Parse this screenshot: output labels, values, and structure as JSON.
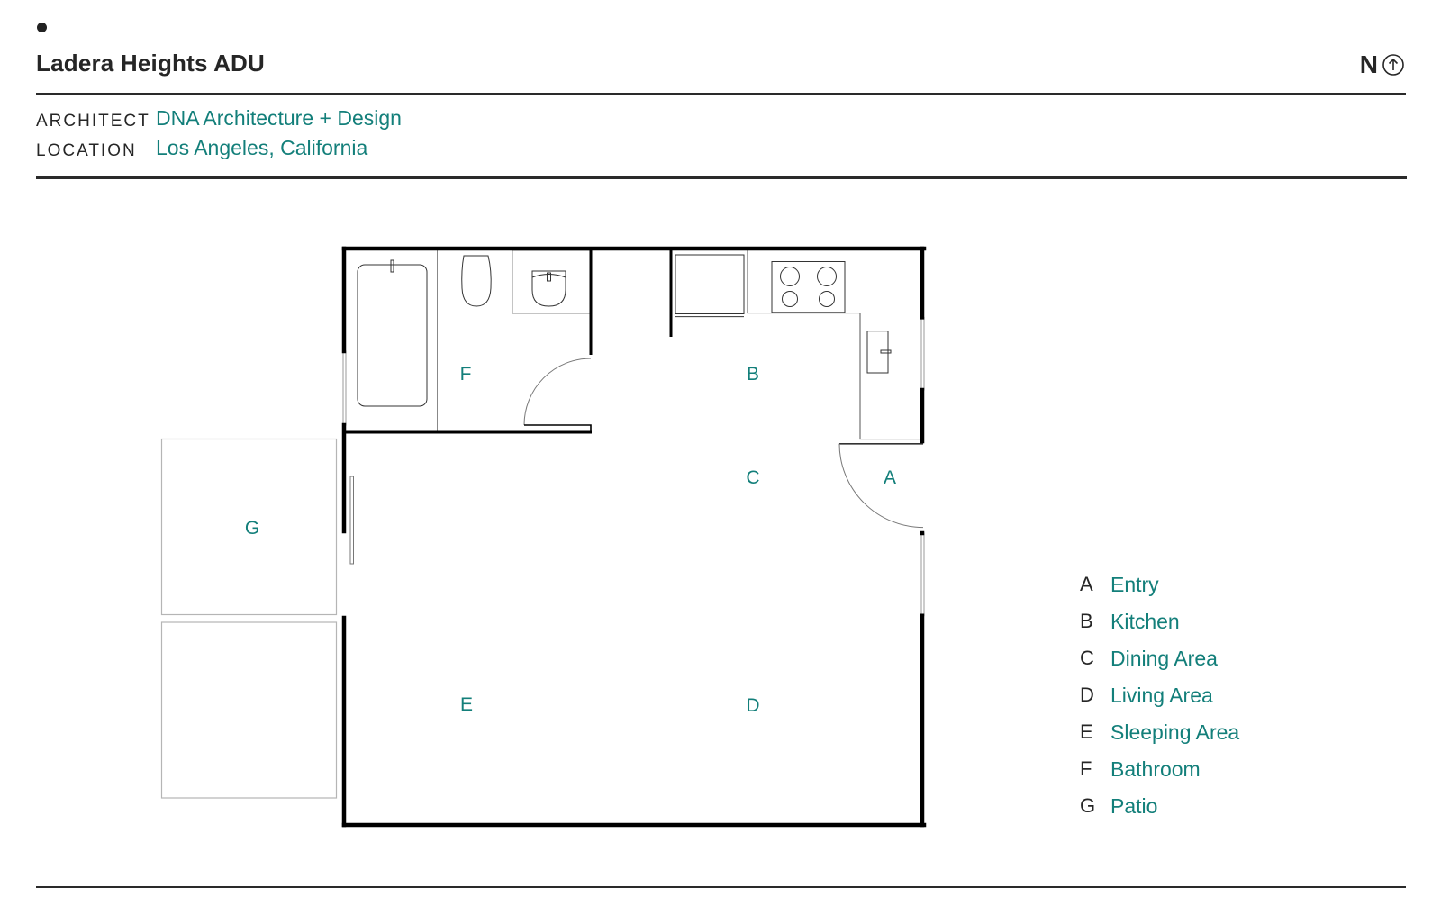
{
  "header": {
    "title": "Ladera Heights ADU",
    "north_label": "N",
    "north_icon": "arrow-up-circle-icon"
  },
  "meta": {
    "architect_label": "ARCHITECT",
    "architect_value": "DNA Architecture + Design",
    "location_label": "LOCATION",
    "location_value": "Los Angeles, California"
  },
  "colors": {
    "accent": "#137f7a",
    "text": "#262626",
    "wall": "#000000"
  },
  "plan": {
    "labels": {
      "A": "A",
      "B": "B",
      "C": "C",
      "D": "D",
      "E": "E",
      "F": "F",
      "G": "G"
    }
  },
  "legend": {
    "items": [
      {
        "key": "A",
        "name": "Entry"
      },
      {
        "key": "B",
        "name": "Kitchen"
      },
      {
        "key": "C",
        "name": "Dining Area"
      },
      {
        "key": "D",
        "name": "Living Area"
      },
      {
        "key": "E",
        "name": "Sleeping Area"
      },
      {
        "key": "F",
        "name": "Bathroom"
      },
      {
        "key": "G",
        "name": "Patio"
      }
    ]
  }
}
